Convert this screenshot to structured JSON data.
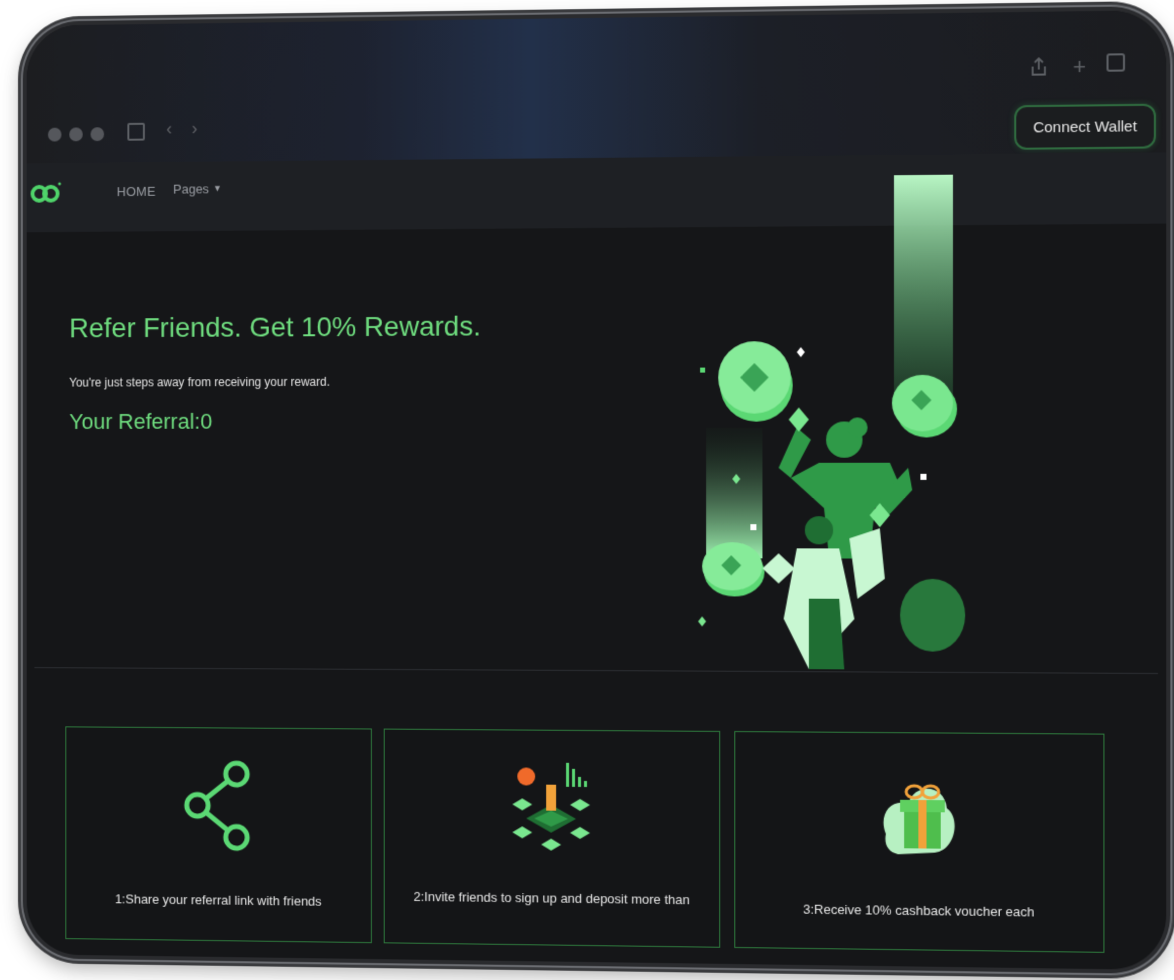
{
  "browser": {
    "connect_wallet_label": "Connect Wallet"
  },
  "nav": {
    "home_label": "HOME",
    "pages_label": "Pages"
  },
  "hero": {
    "title": "Refer Friends. Get 10% Rewards.",
    "subtitle": "You're just steps away from receiving your reward.",
    "referral_label": "Your Referral:",
    "referral_count": "0"
  },
  "steps": [
    {
      "text": "1:Share your referral link with friends",
      "icon": "share-icon"
    },
    {
      "text": "2:Invite friends to sign up and deposit more than",
      "icon": "invite-illustration"
    },
    {
      "text": "3:Receive 10% cashback voucher each",
      "icon": "gift-icon"
    }
  ],
  "colors": {
    "accent": "#6fdd7f",
    "background": "#151618",
    "card_border": "#2e7a3d"
  }
}
